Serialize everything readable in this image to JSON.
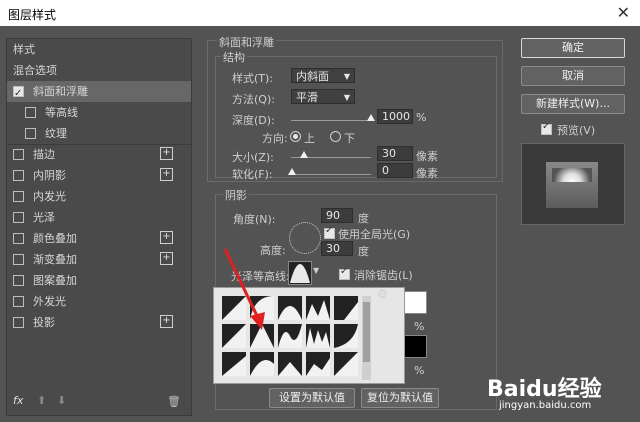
{
  "dialog": {
    "title": "图层样式"
  },
  "sidebar": {
    "items": [
      {
        "label": "样式",
        "checkbox": false,
        "plus": false,
        "level": 0,
        "selected": false
      },
      {
        "label": "混合选项",
        "checkbox": false,
        "plus": false,
        "level": 0,
        "selected": false
      },
      {
        "label": "斜面和浮雕",
        "checkbox": true,
        "checked": true,
        "plus": false,
        "level": 0,
        "selected": true
      },
      {
        "label": "等高线",
        "checkbox": true,
        "checked": false,
        "plus": false,
        "level": 1,
        "selected": false
      },
      {
        "label": "纹理",
        "checkbox": true,
        "checked": false,
        "plus": false,
        "level": 1,
        "selected": false
      },
      {
        "label": "描边",
        "checkbox": true,
        "checked": false,
        "plus": true,
        "level": 0,
        "selected": false
      },
      {
        "label": "内阴影",
        "checkbox": true,
        "checked": false,
        "plus": true,
        "level": 0,
        "selected": false
      },
      {
        "label": "内发光",
        "checkbox": true,
        "checked": false,
        "plus": false,
        "level": 0,
        "selected": false
      },
      {
        "label": "光泽",
        "checkbox": true,
        "checked": false,
        "plus": false,
        "level": 0,
        "selected": false
      },
      {
        "label": "颜色叠加",
        "checkbox": true,
        "checked": false,
        "plus": true,
        "level": 0,
        "selected": false
      },
      {
        "label": "渐变叠加",
        "checkbox": true,
        "checked": false,
        "plus": true,
        "level": 0,
        "selected": false
      },
      {
        "label": "图案叠加",
        "checkbox": true,
        "checked": false,
        "plus": false,
        "level": 0,
        "selected": false
      },
      {
        "label": "外发光",
        "checkbox": true,
        "checked": false,
        "plus": false,
        "level": 0,
        "selected": false
      },
      {
        "label": "投影",
        "checkbox": true,
        "checked": false,
        "plus": true,
        "level": 0,
        "selected": false
      }
    ],
    "fx_label": "fx"
  },
  "bevel": {
    "section_title": "斜面和浮雕",
    "structure_title": "结构",
    "style_label": "样式(T):",
    "style_value": "内斜面",
    "technique_label": "方法(Q):",
    "technique_value": "平滑",
    "depth_label": "深度(D):",
    "depth_value": "1000",
    "depth_unit": "%",
    "direction_label": "方向:",
    "dir_up": "上",
    "dir_down": "下",
    "size_label": "大小(Z):",
    "size_value": "30",
    "size_unit": "像素",
    "soften_label": "软化(F):",
    "soften_value": "0",
    "soften_unit": "像素"
  },
  "shading": {
    "title": "阴影",
    "angle_label": "角度(N):",
    "angle_value": "90",
    "angle_unit": "度",
    "global_light_label": "使用全局光(G)",
    "altitude_label": "高度:",
    "altitude_value": "30",
    "altitude_unit": "度",
    "gloss_label": "光泽等高线:",
    "antialias_label": "消除锯齿(L)",
    "percent1": "%",
    "percent2": "%"
  },
  "buttons": {
    "ok": "确定",
    "cancel": "取消",
    "new_style": "新建样式(W)...",
    "preview": "预览(V)",
    "set_default": "设置为默认值",
    "reset_default": "复位为默认值"
  },
  "watermark": {
    "brand": "Baidu经验",
    "url": "jingyan.baidu.com"
  }
}
